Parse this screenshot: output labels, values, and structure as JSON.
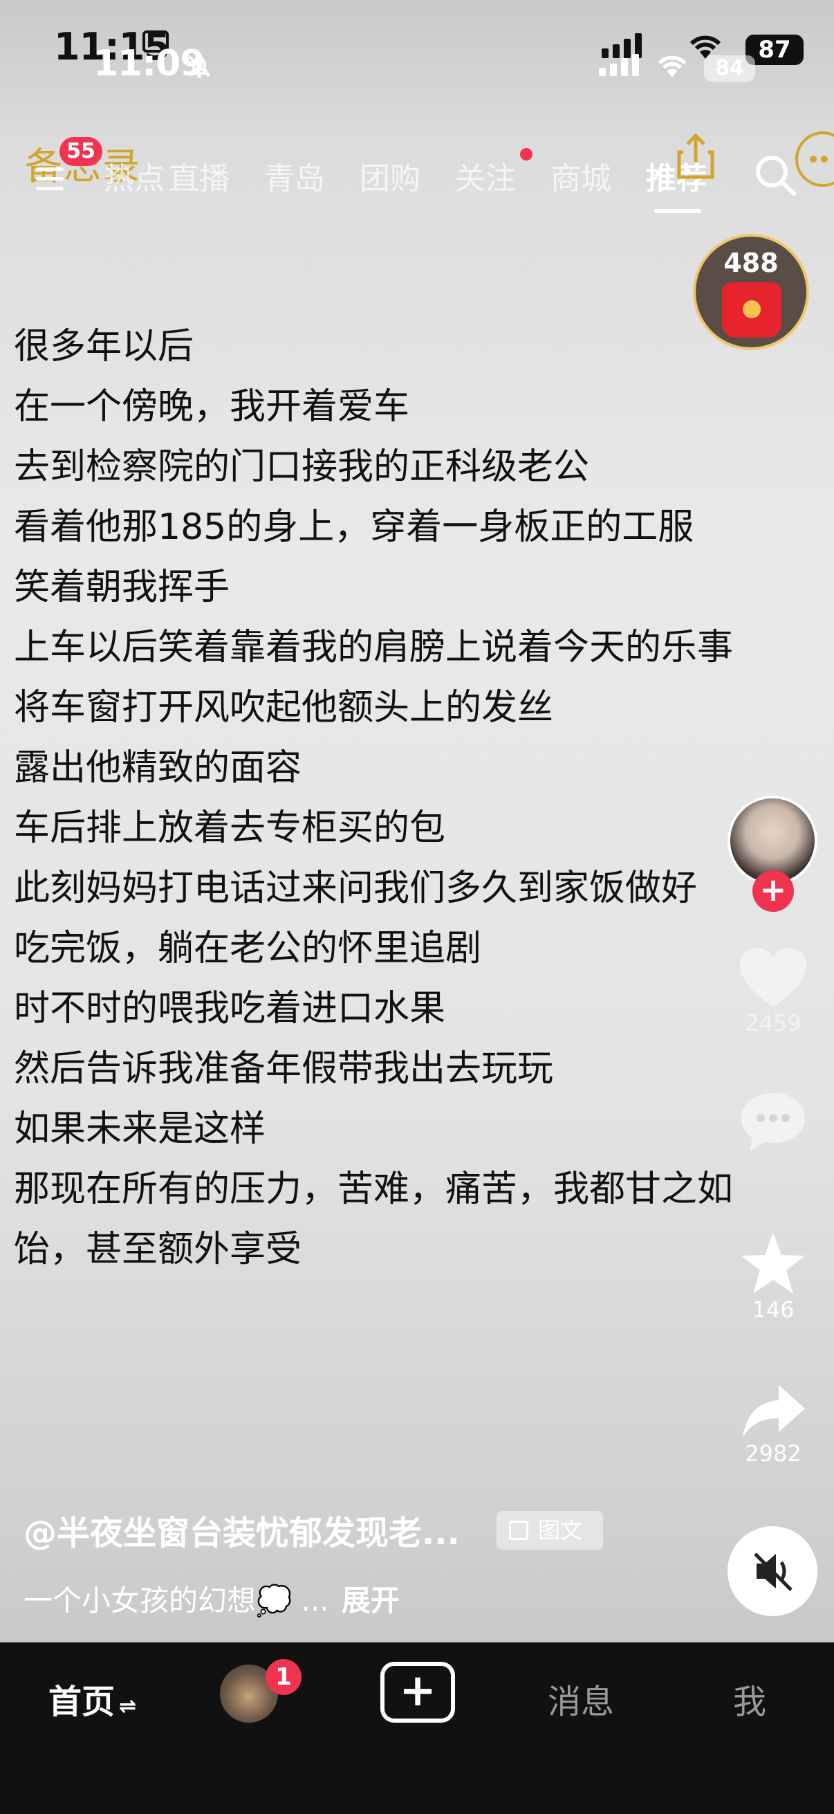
{
  "status_bar": {
    "time_back": "11:15",
    "time_front": "11:09",
    "battery_back": "87",
    "battery_front": "84"
  },
  "top_nav": {
    "ghost_title": "备忘录",
    "menu_badge": "55",
    "tabs": [
      {
        "label": "热点"
      },
      {
        "label": "直播"
      },
      {
        "label": "青岛"
      },
      {
        "label": "团购"
      },
      {
        "label": "关注"
      },
      {
        "label": "商城"
      },
      {
        "label": "推荐"
      }
    ],
    "active_tab": "推荐"
  },
  "red_packet": {
    "count": "488"
  },
  "post": {
    "lines": [
      "很多年以后",
      "在一个傍晚，我开着爱车",
      "去到检察院的门口接我的正科级老公",
      "看着他那185的身上，穿着一身板正的工服",
      "笑着朝我挥手",
      "上车以后笑着靠着我的肩膀上说着今天的乐事",
      "将车窗打开风吹起他额头上的发丝",
      "露出他精致的面容",
      "车后排上放着去专柜买的包",
      "此刻妈妈打电话过来问我们多久到家饭做好",
      "吃完饭，躺在老公的怀里追剧",
      "时不时的喂我吃着进口水果",
      "然后告诉我准备年假带我出去玩玩",
      "如果未来是这样",
      "那现在所有的压力，苦难，痛苦，我都甘之如",
      "饴，甚至额外享受"
    ],
    "author": "@半夜坐窗台装忧郁发现老...",
    "tag": "图文",
    "caption": "一个小女孩的幻想💭 ...",
    "expand": "展开"
  },
  "actions": {
    "likes": "2459",
    "favorites": "146",
    "shares": "2982"
  },
  "bottom_bar": {
    "home": "首页",
    "friends_badge": "1",
    "messages": "消息",
    "me": "我"
  },
  "colors": {
    "accent_red": "#f0344f",
    "gold": "#d2a42a",
    "tabbar_bg": "#111111"
  }
}
